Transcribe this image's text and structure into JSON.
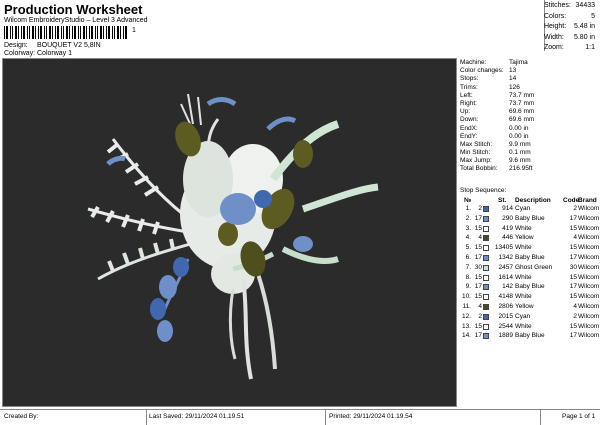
{
  "header": {
    "title": "Production Worksheet",
    "subtitle": "Wilcom EmbroideryStudio – Level 3 Advanced",
    "barcode_suffix": "1",
    "design_label": "Design:",
    "design_value": "BOUQUET V2 5,8IN",
    "colorway_label": "Colorway:",
    "colorway_value": "Colorway 1"
  },
  "stats": [
    {
      "label": "Stitches:",
      "value": "34433"
    },
    {
      "label": "Colors:",
      "value": "5"
    },
    {
      "label": "Height:",
      "value": "5.48 in"
    },
    {
      "label": "Width:",
      "value": "5.80 in"
    },
    {
      "label": "Zoom:",
      "value": "1:1"
    }
  ],
  "machine": [
    {
      "label": "Machine:",
      "value": "Tajima"
    },
    {
      "label": "Color changes:",
      "value": "13"
    },
    {
      "label": "Stops:",
      "value": "14"
    },
    {
      "label": "Trims:",
      "value": "126"
    },
    {
      "label": "Left:",
      "value": "73.7 mm"
    },
    {
      "label": "Right:",
      "value": "73.7 mm"
    },
    {
      "label": "Up:",
      "value": "69.6 mm"
    },
    {
      "label": "Down:",
      "value": "69.6 mm"
    },
    {
      "label": "EndX:",
      "value": "0.00 in"
    },
    {
      "label": "EndY:",
      "value": "0.00 in"
    },
    {
      "label": "Max Stitch:",
      "value": "9.9 mm"
    },
    {
      "label": "Min Stitch:",
      "value": "0.1 mm"
    },
    {
      "label": "Max Jump:",
      "value": "9.6 mm"
    },
    {
      "label": "Total Bobbin:",
      "value": "216.95ft"
    }
  ],
  "sequence": {
    "title": "Stop Sequence:",
    "headers": {
      "n": "№",
      "st": "St.",
      "desc": "Description",
      "code": "Code",
      "brand": "Brand"
    },
    "rows": [
      {
        "idx": "1.",
        "stop": "2",
        "color": "#3f68b0",
        "st": "914",
        "desc": "Cyan",
        "code": "2",
        "brand": "Wilcom"
      },
      {
        "idx": "2.",
        "stop": "17",
        "color": "#6f8fc8",
        "st": "290",
        "desc": "Baby Blue",
        "code": "17",
        "brand": "Wilcom"
      },
      {
        "idx": "3.",
        "stop": "15",
        "color": "#ffffff",
        "st": "419",
        "desc": "White",
        "code": "15",
        "brand": "Wilcom"
      },
      {
        "idx": "4.",
        "stop": "4",
        "color": "#4a4a1c",
        "st": "446",
        "desc": "Yellow",
        "code": "4",
        "brand": "Wilcom"
      },
      {
        "idx": "5.",
        "stop": "15",
        "color": "#ffffff",
        "st": "13405",
        "desc": "White",
        "code": "15",
        "brand": "Wilcom"
      },
      {
        "idx": "6.",
        "stop": "17",
        "color": "#6f8fc8",
        "st": "1342",
        "desc": "Baby Blue",
        "code": "17",
        "brand": "Wilcom"
      },
      {
        "idx": "7.",
        "stop": "30",
        "color": "#cfe6d4",
        "st": "2457",
        "desc": "Ghost Green",
        "code": "30",
        "brand": "Wilcom"
      },
      {
        "idx": "8.",
        "stop": "15",
        "color": "#ffffff",
        "st": "1614",
        "desc": "White",
        "code": "15",
        "brand": "Wilcom"
      },
      {
        "idx": "9.",
        "stop": "17",
        "color": "#6f8fc8",
        "st": "142",
        "desc": "Baby Blue",
        "code": "17",
        "brand": "Wilcom"
      },
      {
        "idx": "10.",
        "stop": "15",
        "color": "#ffffff",
        "st": "4148",
        "desc": "White",
        "code": "15",
        "brand": "Wilcom"
      },
      {
        "idx": "11.",
        "stop": "4",
        "color": "#4a4a1c",
        "st": "2806",
        "desc": "Yellow",
        "code": "4",
        "brand": "Wilcom"
      },
      {
        "idx": "12.",
        "stop": "2",
        "color": "#3f68b0",
        "st": "2015",
        "desc": "Cyan",
        "code": "2",
        "brand": "Wilcom"
      },
      {
        "idx": "13.",
        "stop": "15",
        "color": "#ffffff",
        "st": "2544",
        "desc": "White",
        "code": "15",
        "brand": "Wilcom"
      },
      {
        "idx": "14.",
        "stop": "17",
        "color": "#6f8fc8",
        "st": "1889",
        "desc": "Baby Blue",
        "code": "17",
        "brand": "Wilcom"
      }
    ]
  },
  "footer": {
    "created_by": "Created By:",
    "last_saved": "Last Saved: 29/11/2024 01.19.51",
    "printed": "Printed: 29/11/2024 01.19.54",
    "page": "Page 1 of 1"
  }
}
